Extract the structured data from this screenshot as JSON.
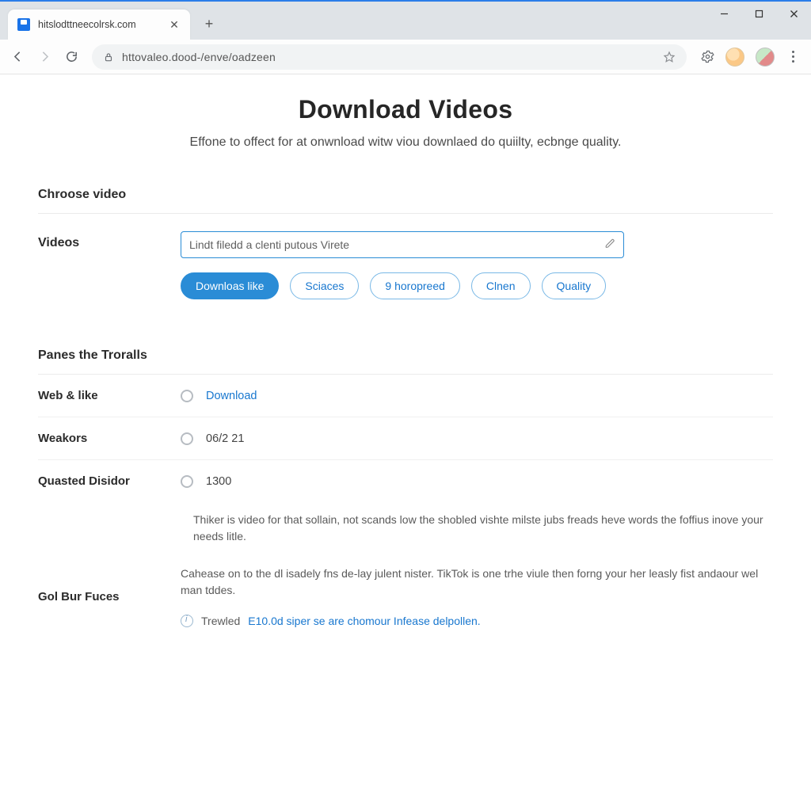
{
  "browser": {
    "tab_title": "hitslodttneecolrsk.com",
    "url": "httovaleo.dood-/enve/oadzeen"
  },
  "hero": {
    "title": "Download Videos",
    "subtitle": "Effone to offect for at onwnload witw viou downlaed do quiilty, ecbnge quality."
  },
  "section1": {
    "title": "Chroose video",
    "row_label": "Videos",
    "input_value": "Lindt filedd a clenti putous Virete",
    "chips": {
      "primary": "Downloas like",
      "c2": "Sciaces",
      "c3": "9 horopreed",
      "c4": "Clnen",
      "c5": "Quality"
    }
  },
  "section2": {
    "title": "Panes the Troralls",
    "rows": {
      "r1": {
        "label": "Web & like",
        "value": "Download"
      },
      "r2": {
        "label": "Weakors",
        "value": "06/2 21"
      },
      "r3": {
        "label": "Quasted Disidor",
        "value": "1300"
      },
      "r4": {
        "label": "Gol Bur Fuces"
      }
    },
    "help1": "Thiker is video for that sollain, not scands low the shobled vishte milste jubs freads heve words the foffius inove your needs litle.",
    "help2": "Cahease on to the dl isadely fns de-lay julent nister. TikTok is one trhe viule then forng your her leasly fist andaour wel man tddes.",
    "info_dark": "Trewled",
    "info_link": "E10.0d siper se are chomour Infease delpollen."
  }
}
